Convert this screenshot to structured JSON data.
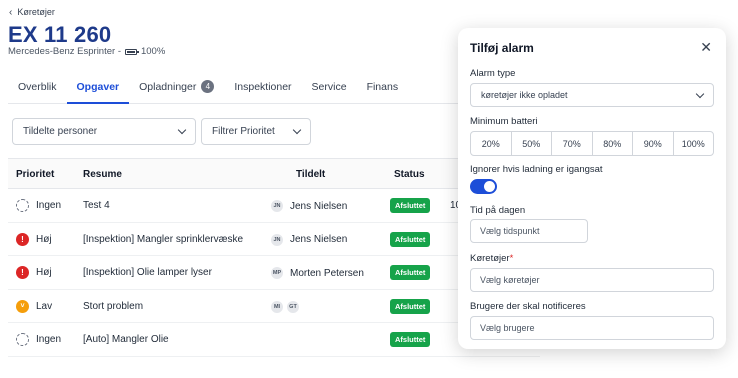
{
  "header": {
    "back_label": "Køretøjer",
    "title": "EX 11 260",
    "subtitle": "Mercedes-Benz Esprinter -",
    "battery_pct": "100%"
  },
  "tabs": [
    {
      "label": "Overblik"
    },
    {
      "label": "Opgaver",
      "active": true
    },
    {
      "label": "Opladninger",
      "count": "4"
    },
    {
      "label": "Inspektioner"
    },
    {
      "label": "Service"
    },
    {
      "label": "Finans"
    }
  ],
  "filters": {
    "assigned": "Tildelte personer",
    "priority": "Filtrer Prioritet"
  },
  "table": {
    "columns": [
      "Prioritet",
      "Resume",
      "Tildelt",
      "Status"
    ],
    "rows": [
      {
        "priority": "Ingen",
        "prio_icon": "dashed-circle-icon",
        "resume": "Test 4",
        "avatars": [
          "JN"
        ],
        "assigned": "Jens Nielsen",
        "status": "Afsluttet",
        "extra": "10"
      },
      {
        "priority": "Høj",
        "prio_icon": "exclamation-icon",
        "resume": "[Inspektion] Mangler sprinklervæske",
        "avatars": [
          "JN"
        ],
        "assigned": "Jens Nielsen",
        "status": "Afsluttet",
        "extra": ""
      },
      {
        "priority": "Høj",
        "prio_icon": "exclamation-icon",
        "resume": "[Inspektion] Olie lamper lyser",
        "avatars": [
          "MP"
        ],
        "assigned": "Morten Petersen",
        "status": "Afsluttet",
        "extra": ""
      },
      {
        "priority": "Lav",
        "prio_icon": "chevron-down-icon",
        "resume": "Stort problem",
        "avatars": [
          "MI",
          "GT"
        ],
        "assigned": "",
        "status": "Afsluttet",
        "extra": ""
      },
      {
        "priority": "Ingen",
        "prio_icon": "dashed-circle-icon",
        "resume": "[Auto] Mangler Olie",
        "avatars": [],
        "assigned": "",
        "status": "Afsluttet",
        "extra": ""
      }
    ]
  },
  "panel": {
    "title": "Tilføj alarm",
    "alarm_type_label": "Alarm type",
    "alarm_type_value": "køretøjer ikke opladet",
    "min_battery_label": "Minimum batteri",
    "battery_options": [
      "20%",
      "50%",
      "70%",
      "80%",
      "90%",
      "100%"
    ],
    "ignore_label": "Ignorer hvis ladning er igangsat",
    "ignore_enabled": true,
    "time_label": "Tid på dagen",
    "time_placeholder": "Vælg tidspunkt",
    "vehicles_label": "Køretøjer",
    "vehicles_placeholder": "Vælg køretøjer",
    "users_label": "Brugere der skal notificeres",
    "users_placeholder": "Vælg brugere"
  },
  "colors": {
    "accent": "#1d4ed8",
    "title": "#1e3a8a",
    "status_done": "#16a34a",
    "priority_high": "#dc2626",
    "priority_low": "#f59e0b"
  }
}
